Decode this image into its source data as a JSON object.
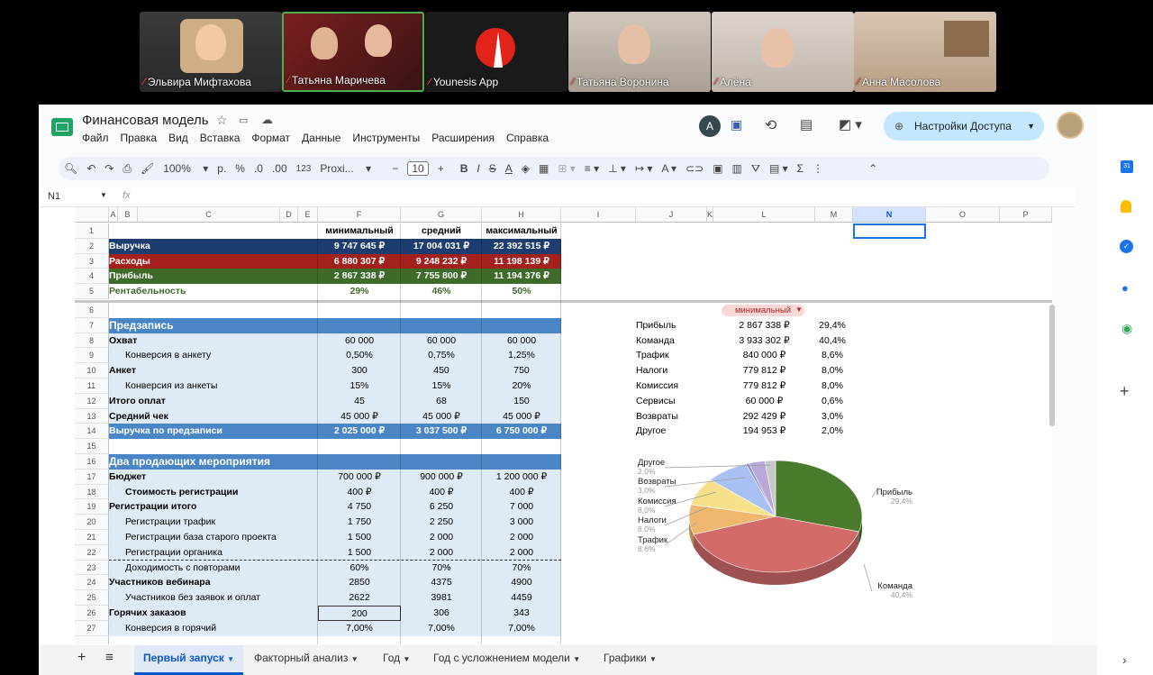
{
  "participants": [
    {
      "name": "Эльвира Мифтахова",
      "active": false
    },
    {
      "name": "Татьяна Маричева",
      "active": true
    },
    {
      "name": "Younesis App",
      "active": false
    },
    {
      "name": "Татьяна Воронина",
      "active": false
    },
    {
      "name": "Алёна",
      "active": false
    },
    {
      "name": "Анна Масолова",
      "active": false
    }
  ],
  "doc": {
    "title": "Финансовая модель",
    "share": "Настройки Доступа",
    "avatar": "A"
  },
  "menu": [
    "Файл",
    "Правка",
    "Вид",
    "Вставка",
    "Формат",
    "Данные",
    "Инструменты",
    "Расширения",
    "Справка"
  ],
  "toolbar": {
    "zoom": "100%",
    "currency": "р.",
    "percent": "%",
    "dec_minus": ".0",
    "dec_plus": ".00",
    "fmt": "123",
    "font": "Proxi...",
    "size": "10"
  },
  "namebox": "N1",
  "fx": "fx",
  "cols": [
    "A",
    "B",
    "C",
    "D",
    "E",
    "F",
    "G",
    "H",
    "I",
    "J",
    "K",
    "L",
    "M",
    "N",
    "O",
    "P"
  ],
  "top_headers": [
    "минимальный",
    "средний",
    "максимальный"
  ],
  "summary": [
    {
      "row": "2",
      "label": "Выручка",
      "v": [
        "9 747 645 ₽",
        "17 004 031 ₽",
        "22 392 515 ₽"
      ]
    },
    {
      "row": "3",
      "label": "Расходы",
      "v": [
        "6 880 307 ₽",
        "9 248 232 ₽",
        "11 198 139 ₽"
      ]
    },
    {
      "row": "4",
      "label": "Прибыль",
      "v": [
        "2 867 338 ₽",
        "7 755 800 ₽",
        "11 194 376 ₽"
      ]
    },
    {
      "row": "5",
      "label": "Рентабельность",
      "v": [
        "29%",
        "46%",
        "50%"
      ]
    }
  ],
  "section1": "Предзапись",
  "rows1": [
    {
      "row": "8",
      "label": "Охват",
      "bold": true,
      "indent": false,
      "v": [
        "60 000",
        "60 000",
        "60 000"
      ]
    },
    {
      "row": "9",
      "label": "Конверсия в анкету",
      "bold": false,
      "indent": true,
      "v": [
        "0,50%",
        "0,75%",
        "1,25%"
      ]
    },
    {
      "row": "10",
      "label": "Анкет",
      "bold": true,
      "indent": false,
      "v": [
        "300",
        "450",
        "750"
      ]
    },
    {
      "row": "11",
      "label": "Конверсия из анкеты",
      "bold": false,
      "indent": true,
      "v": [
        "15%",
        "15%",
        "20%"
      ]
    },
    {
      "row": "12",
      "label": "Итого оплат",
      "bold": true,
      "indent": false,
      "v": [
        "45",
        "68",
        "150"
      ]
    },
    {
      "row": "13",
      "label": "Средний чек",
      "bold": true,
      "indent": false,
      "v": [
        "45 000 ₽",
        "45 000 ₽",
        "45 000 ₽"
      ]
    }
  ],
  "total1": {
    "row": "14",
    "label": "Выручка по предзаписи",
    "v": [
      "2 025 000 ₽",
      "3 037 500 ₽",
      "6 750 000 ₽"
    ]
  },
  "section2": "Два продающих мероприятия",
  "rows2": [
    {
      "row": "17",
      "label": "Бюджет",
      "bold": true,
      "indent": false,
      "v": [
        "700 000 ₽",
        "900 000 ₽",
        "1 200 000 ₽"
      ]
    },
    {
      "row": "18",
      "label": "Стоимость регистрации",
      "bold": true,
      "indent": true,
      "v": [
        "400 ₽",
        "400 ₽",
        "400 ₽"
      ]
    },
    {
      "row": "19",
      "label": "Регистрации итого",
      "bold": true,
      "indent": false,
      "v": [
        "4 750",
        "6 250",
        "7 000"
      ]
    },
    {
      "row": "20",
      "label": "Регистрации трафик",
      "bold": false,
      "indent": true,
      "v": [
        "1 750",
        "2 250",
        "3 000"
      ]
    },
    {
      "row": "21",
      "label": "Регистрации база старого проекта",
      "bold": false,
      "indent": true,
      "v": [
        "1 500",
        "2 000",
        "2 000"
      ]
    },
    {
      "row": "22",
      "label": "Регистрации органика",
      "bold": false,
      "indent": true,
      "v": [
        "1 500",
        "2 000",
        "2 000"
      ]
    },
    {
      "row": "23",
      "label": "Доходимость с повторами",
      "bold": false,
      "indent": true,
      "v": [
        "60%",
        "70%",
        "70%"
      ]
    },
    {
      "row": "24",
      "label": "Участников вебинара",
      "bold": true,
      "indent": false,
      "v": [
        "2850",
        "4375",
        "4900"
      ]
    },
    {
      "row": "25",
      "label": "Участников без заявок и оплат",
      "bold": false,
      "indent": true,
      "v": [
        "2622",
        "3981",
        "4459"
      ]
    },
    {
      "row": "26",
      "label": "Горячих заказов",
      "bold": true,
      "indent": false,
      "v": [
        "200",
        "306",
        "343"
      ]
    },
    {
      "row": "27",
      "label": "Конверсия в горячий",
      "bold": false,
      "indent": true,
      "v": [
        "7,00%",
        "7,00%",
        "7,00%"
      ]
    }
  ],
  "row_nums_plain": [
    "1",
    "6",
    "15",
    "16"
  ],
  "dropdown": "минимальный",
  "breakdown": [
    {
      "label": "Прибыль",
      "value": "2 867 338 ₽",
      "pct": "29,4%"
    },
    {
      "label": "Команда",
      "value": "3 933 302 ₽",
      "pct": "40,4%"
    },
    {
      "label": "Трафик",
      "value": "840 000 ₽",
      "pct": "8,6%"
    },
    {
      "label": "Налоги",
      "value": "779 812 ₽",
      "pct": "8,0%"
    },
    {
      "label": "Комиссия",
      "value": "779 812 ₽",
      "pct": "8,0%"
    },
    {
      "label": "Сервисы",
      "value": "60 000 ₽",
      "pct": "0,6%"
    },
    {
      "label": "Возвраты",
      "value": "292 429 ₽",
      "pct": "3,0%"
    },
    {
      "label": "Другое",
      "value": "194 953 ₽",
      "pct": "2,0%"
    }
  ],
  "chart_data": {
    "type": "pie",
    "categories": [
      "Прибыль",
      "Команда",
      "Трафик",
      "Налоги",
      "Комиссия",
      "Сервисы",
      "Возвраты",
      "Другое"
    ],
    "values": [
      29.4,
      40.4,
      8.6,
      8.0,
      8.0,
      0.6,
      3.0,
      2.0
    ],
    "labels": [
      "29,4%",
      "40,4%",
      "8,6%",
      "8,0%",
      "8,0%",
      "0,6%",
      "3,0%",
      "2,0%"
    ],
    "colors": [
      "#4a7a2c",
      "#d46b6b",
      "#f0b86e",
      "#f6e08a",
      "#a9c1f2",
      "#8d8fd4",
      "#b9a9d9",
      "#c8c8c8"
    ],
    "legend": "labels"
  },
  "tabs": [
    "Первый запуск",
    "Факторный анализ",
    "Год",
    "Год с усложнением модели",
    "Графики"
  ],
  "colors": {
    "navy": "#1c3d6e",
    "red": "#a3201c",
    "green": "#3f6b2a",
    "blue": "#4a86c5",
    "light": "#deeaf6"
  }
}
